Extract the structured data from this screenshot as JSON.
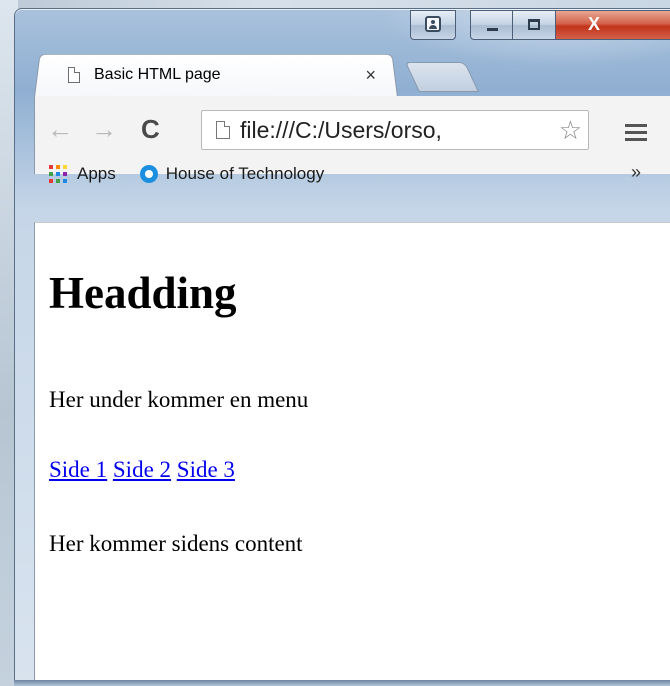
{
  "tab": {
    "title": "Basic HTML page",
    "close": "×"
  },
  "toolbar": {
    "back": "←",
    "forward": "→",
    "reload": "C",
    "url": "file:///C:/Users/orso,",
    "star": "☆"
  },
  "bookmarks": {
    "apps_label": "Apps",
    "items": [
      {
        "label": "House of Technology",
        "icon": "globe-icon"
      }
    ],
    "overflow": "»"
  },
  "window_buttons": {
    "close": "X"
  },
  "page": {
    "heading": "Headding",
    "intro": "Her under kommer en menu",
    "links": [
      "Side 1",
      "Side 2",
      "Side 3"
    ],
    "content": "Her kommer sidens content"
  },
  "colors": {
    "link": "#0000ee",
    "close_button": "#c0341a",
    "apps": [
      "#e53935",
      "#fb8c00",
      "#fdd835",
      "#43a047",
      "#1e88e5",
      "#8e24aa",
      "#e53935",
      "#43a047",
      "#1e88e5"
    ]
  }
}
